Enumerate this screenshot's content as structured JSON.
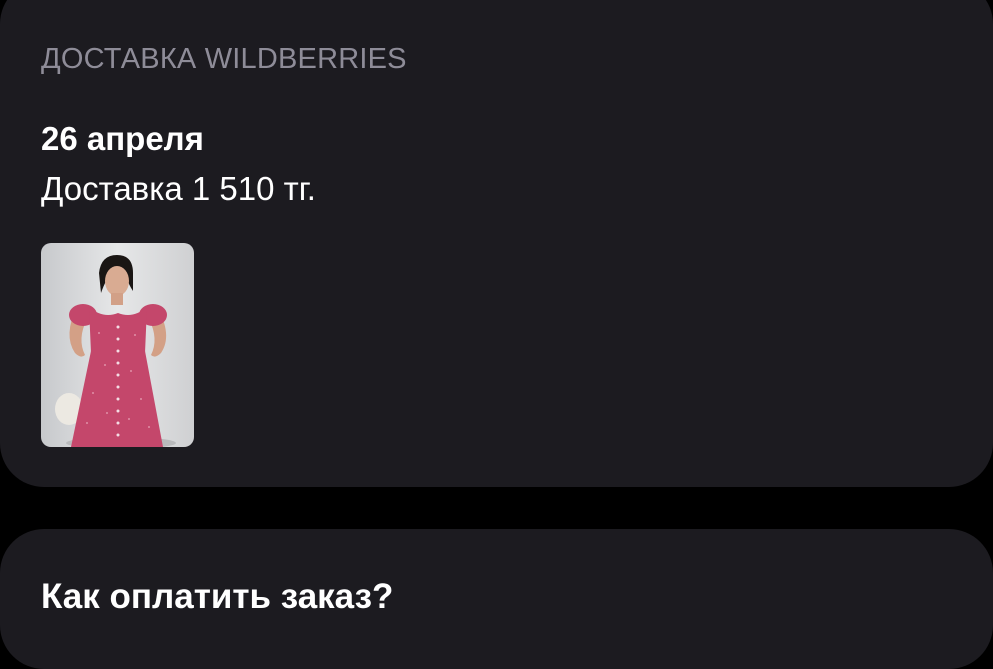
{
  "delivery": {
    "section_title": "ДОСТАВКА WILDBERRIES",
    "date": "26 апреля",
    "cost": "Доставка 1 510 тг.",
    "product": {
      "image": "pink-dress-photo"
    }
  },
  "payment": {
    "title": "Как оплатить заказ?"
  },
  "colors": {
    "background": "#000000",
    "card": "#1c1b20",
    "label": "#8e8c98",
    "text": "#ffffff",
    "dress": "#c4476b"
  }
}
